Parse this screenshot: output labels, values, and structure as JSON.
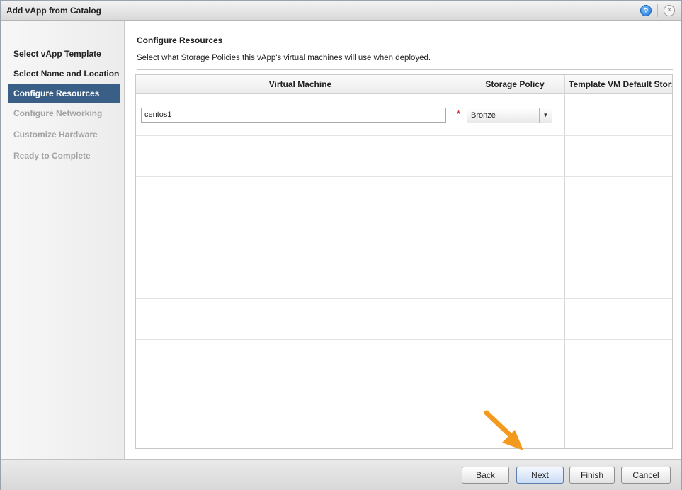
{
  "window": {
    "title": "Add vApp from Catalog"
  },
  "titlebar": {
    "help_glyph": "?",
    "close_glyph": "×"
  },
  "sidebar": {
    "steps": [
      {
        "label": "Select vApp Template",
        "state": "done"
      },
      {
        "label": "Select Name and Location",
        "state": "done"
      },
      {
        "label": "Configure Resources",
        "state": "active"
      },
      {
        "label": "Configure Networking",
        "state": "disabled"
      },
      {
        "label": "Customize Hardware",
        "state": "disabled"
      },
      {
        "label": "Ready to Complete",
        "state": "disabled"
      }
    ]
  },
  "main": {
    "title": "Configure Resources",
    "description": "Select what Storage Policies this vApp's virtual machines will use when deployed.",
    "table": {
      "columns": [
        "Virtual Machine",
        "Storage Policy",
        "Template VM Default Stor:"
      ],
      "rows": [
        {
          "vm_name": "centos1",
          "required_mark": "*",
          "storage_policy": "Bronze",
          "template_default": ""
        }
      ]
    }
  },
  "footer": {
    "back_label": "Back",
    "next_label": "Next",
    "finish_label": "Finish",
    "cancel_label": "Cancel"
  },
  "colors": {
    "active_step": "#3a5f86",
    "annotation_arrow": "#f39a1e",
    "required": "#d43b3b"
  },
  "icons": {
    "help": "help-icon",
    "close": "close-icon",
    "dropdown": "chevron-down-icon",
    "annotation": "arrow-pointer-icon"
  }
}
